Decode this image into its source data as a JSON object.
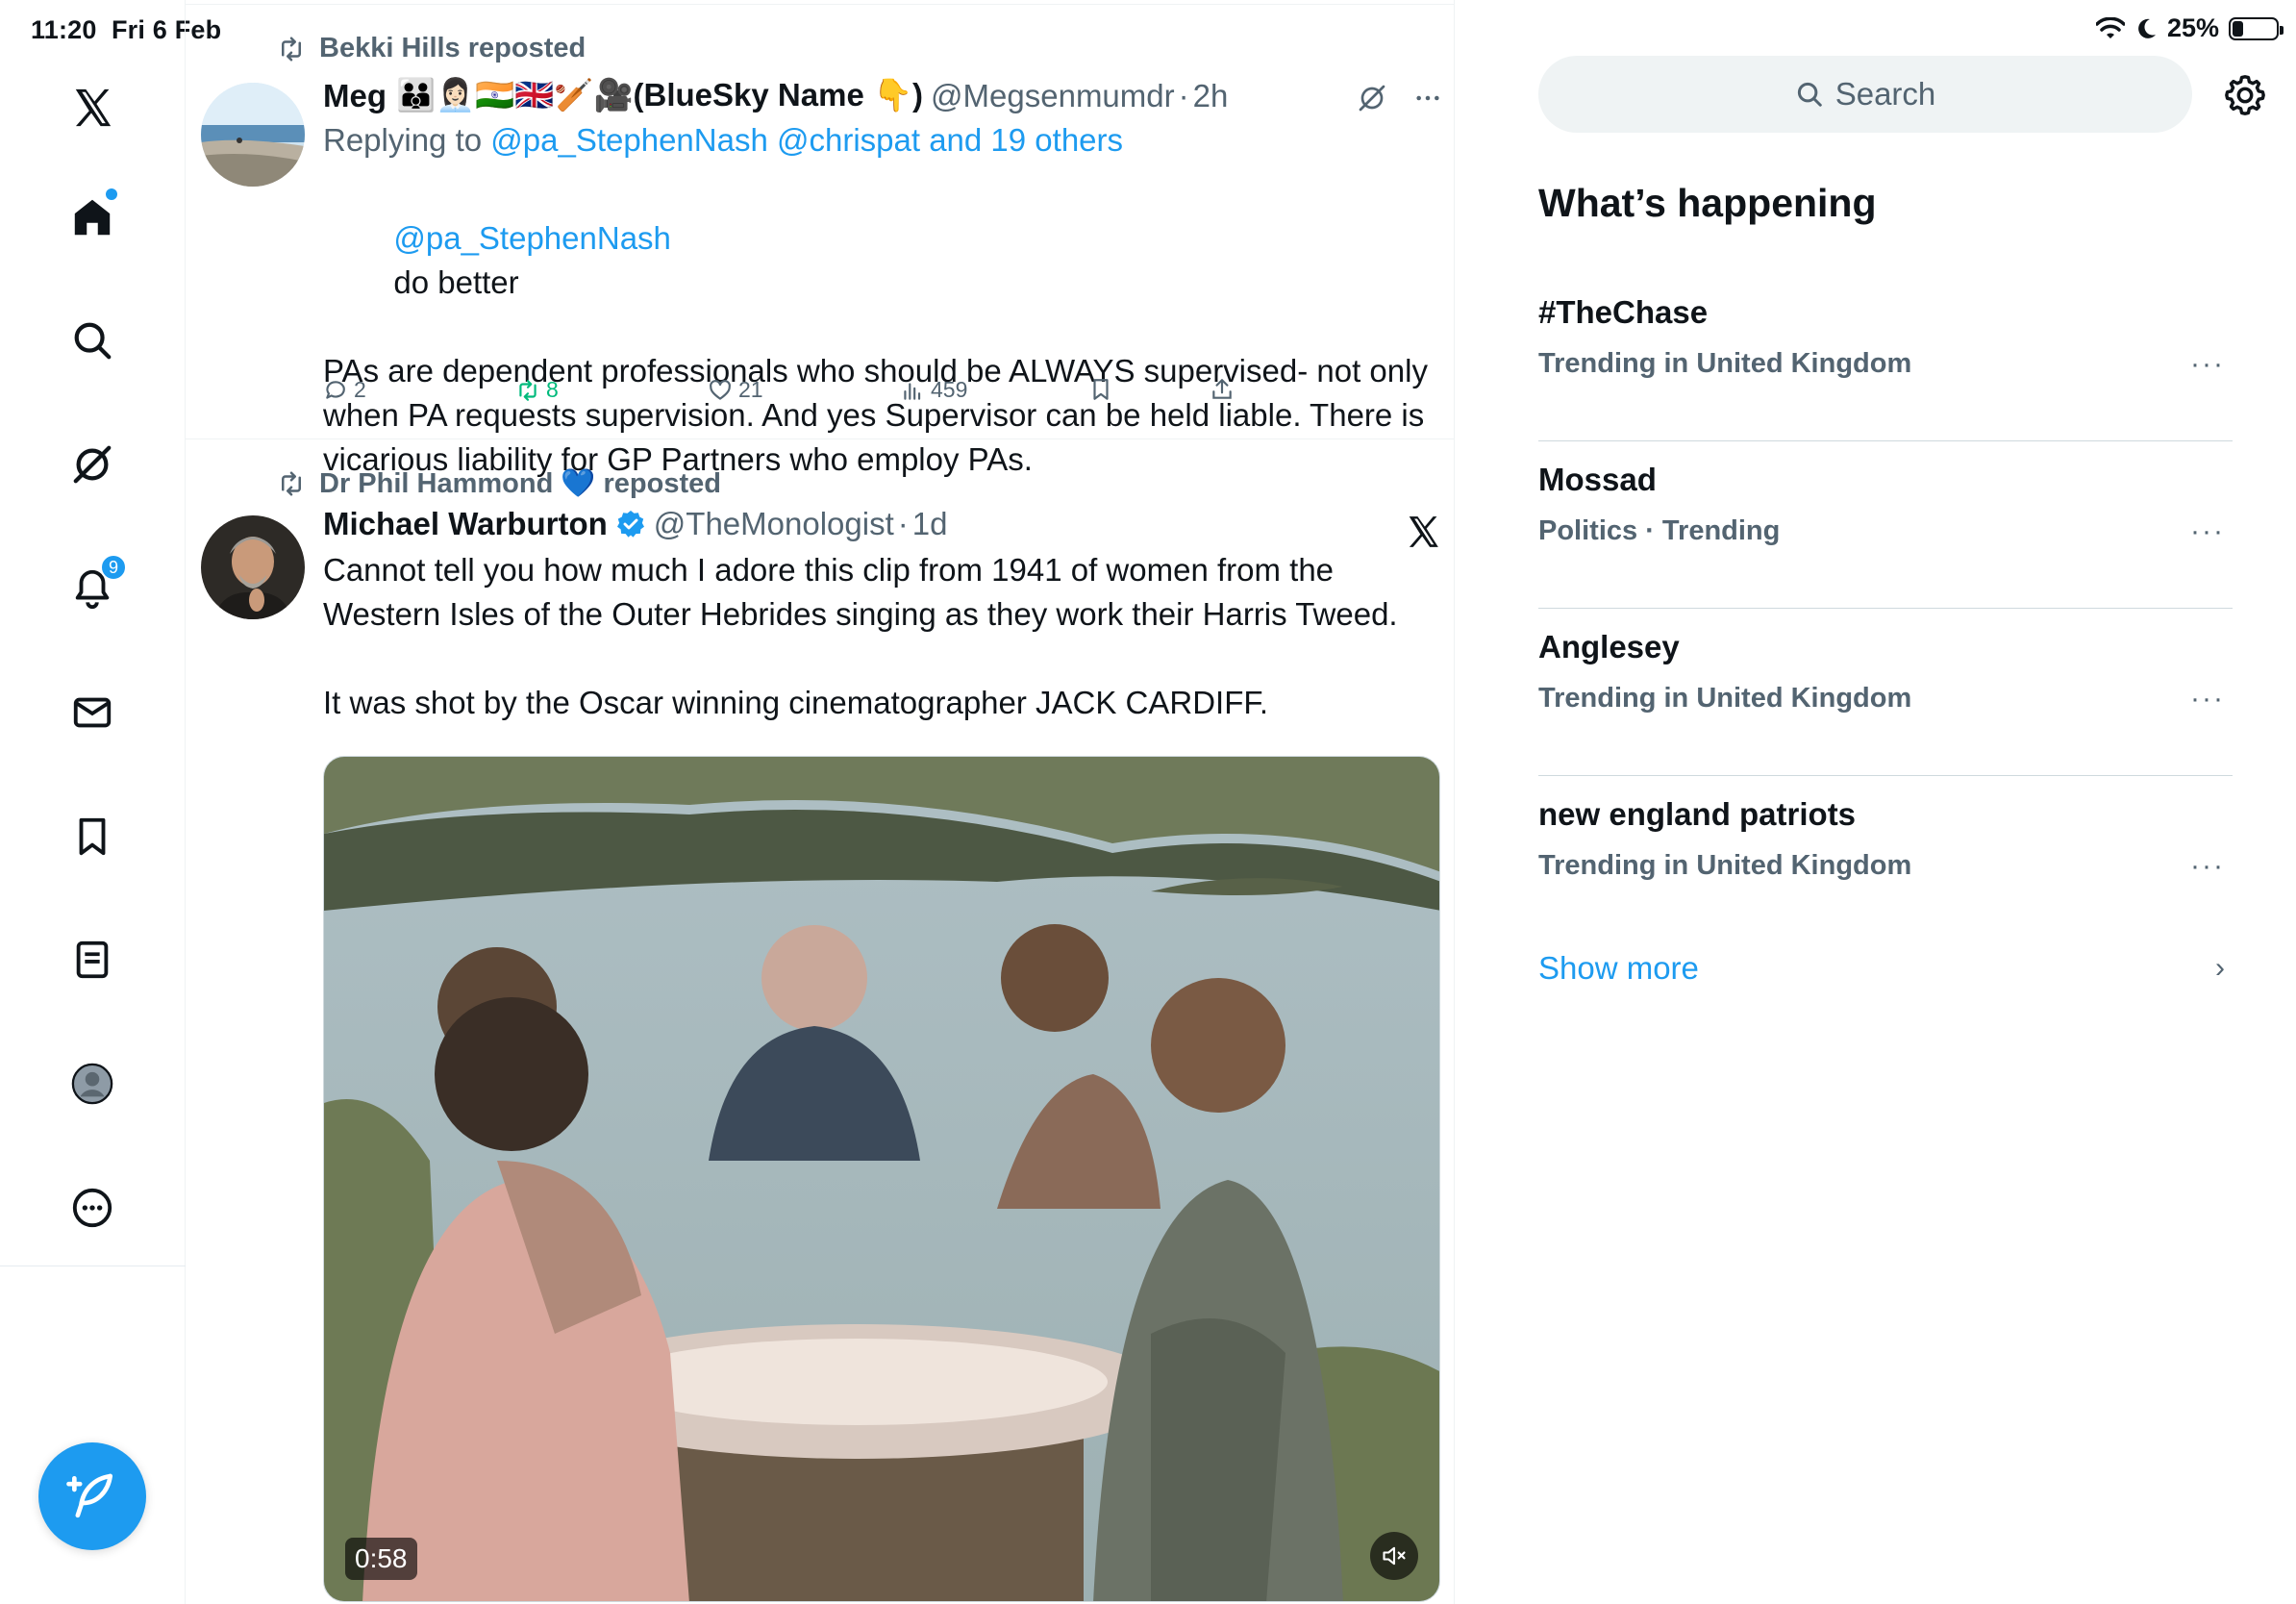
{
  "status_bar": {
    "time": "11:20",
    "date": "Fri 6 Feb",
    "battery": "25%",
    "battery_level": 0.25
  },
  "nav": {
    "items": [
      {
        "name": "x-logo-icon"
      },
      {
        "name": "home-icon"
      },
      {
        "name": "search-icon"
      },
      {
        "name": "grok-icon"
      },
      {
        "name": "notifications-icon",
        "badge": "9"
      },
      {
        "name": "messages-icon"
      },
      {
        "name": "bookmarks-icon"
      },
      {
        "name": "lists-icon"
      },
      {
        "name": "profile-icon"
      },
      {
        "name": "more-icon"
      }
    ],
    "compose_icon": "compose-icon"
  },
  "timeline": {
    "tweets": [
      {
        "repost_by": "Bekki Hills reposted",
        "name": "Meg",
        "name_emoji": "👪👩🏻‍💼🇮🇳🇬🇧🏏🎥(BlueSky Name 👇)",
        "handle": "@Megsenmumdr",
        "time": "2h",
        "reply_prefix": "Replying to",
        "reply_targets": "@pa_StephenNash @chrispat and 19 others",
        "mention": "@pa_StephenNash",
        "text_after_mention": "do better",
        "text": "PAs are dependent professionals who should be ALWAYS supervised- not only when PA requests supervision. And yes Supervisor can be held liable. There is vicarious liability for GP Partners who employ PAs.",
        "stats": {
          "replies": "2",
          "reposts": "8",
          "likes": "21",
          "views": "459"
        }
      },
      {
        "repost_by": "Dr Phil Hammond 💙 reposted",
        "name": "Michael Warburton",
        "handle": "@TheMonologist",
        "time": "1d",
        "text": "Cannot tell you how much I adore this clip from 1941 of women from the Western Isles of the Outer Hebrides singing as they work their Harris Tweed.\n\nIt was shot by the Oscar winning cinematographer JACK CARDIFF.",
        "video_duration": "0:58"
      }
    ]
  },
  "sidebar": {
    "search_placeholder": "Search",
    "section_title": "What’s happening",
    "trends": [
      {
        "name": "#TheChase",
        "meta": "Trending in United Kingdom"
      },
      {
        "name": "Mossad",
        "meta": "Politics · Trending"
      },
      {
        "name": "Anglesey",
        "meta": "Trending in United Kingdom"
      },
      {
        "name": "new england patriots",
        "meta": "Trending in United Kingdom"
      }
    ],
    "show_more": "Show more"
  },
  "colors": {
    "accent": "#1d9bf0",
    "text": "#0f1419",
    "muted": "#536471",
    "repost_green": "#00ba7c"
  }
}
